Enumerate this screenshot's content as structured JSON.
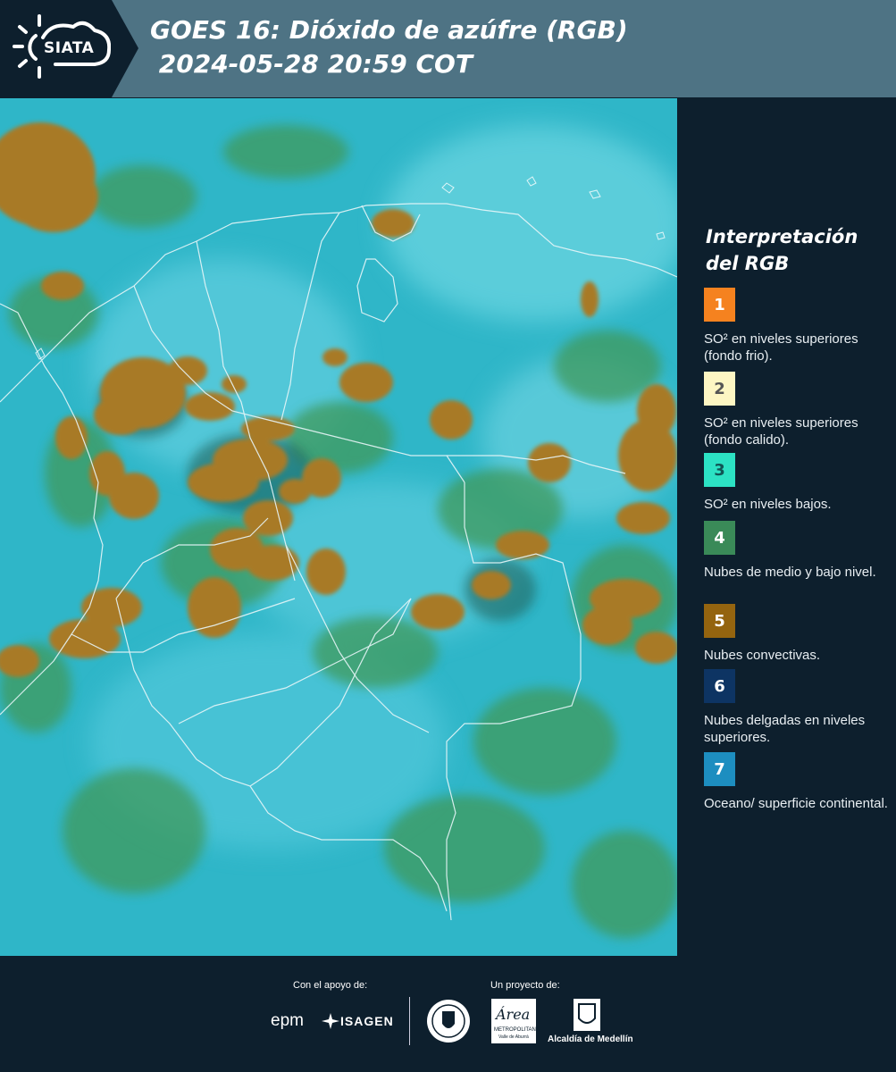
{
  "header": {
    "logo_text": "SIATA",
    "title_line1": "GOES 16: Dióxido de azúfre (RGB)",
    "title_line2": " 2024-05-28 20:59 COT"
  },
  "legend": {
    "title": "Interpretación del RGB",
    "items": [
      {
        "number": "1",
        "color": "#f5821f",
        "text": "SO² en niveles superiores (fondo frio)."
      },
      {
        "number": "2",
        "color": "#fdf6c3",
        "text": "SO² en niveles superiores (fondo calido)."
      },
      {
        "number": "3",
        "color": "#2ce2c4",
        "text": "SO² en niveles bajos."
      },
      {
        "number": "4",
        "color": "#3a8a58",
        "text": "Nubes de medio y bajo nivel."
      },
      {
        "number": "5",
        "color": "#94640f",
        "text": "Nubes convectivas."
      },
      {
        "number": "6",
        "color": "#0d3463",
        "text": "Nubes delgadas en niveles superiores."
      },
      {
        "number": "7",
        "color": "#1d8ec0",
        "text": "Oceano/ superficie continental."
      }
    ]
  },
  "footer": {
    "support_label": "Con el apoyo de:",
    "project_label": "Un proyecto de:",
    "epm_logo": "epm",
    "isagen_logo": "ISAGEN",
    "metro_logo": "Área",
    "metro_sub": "METROPOLITANA",
    "metro_sub2": "Valle de Aburrá",
    "alcaldia_text": "Alcaldía de Medellín"
  },
  "colors": {
    "background": "#0d1f2d",
    "header": "#4e7384",
    "ocean": "#2fb6c8",
    "convective_cloud": "#a87a25",
    "low_cloud": "#4a9a58"
  }
}
